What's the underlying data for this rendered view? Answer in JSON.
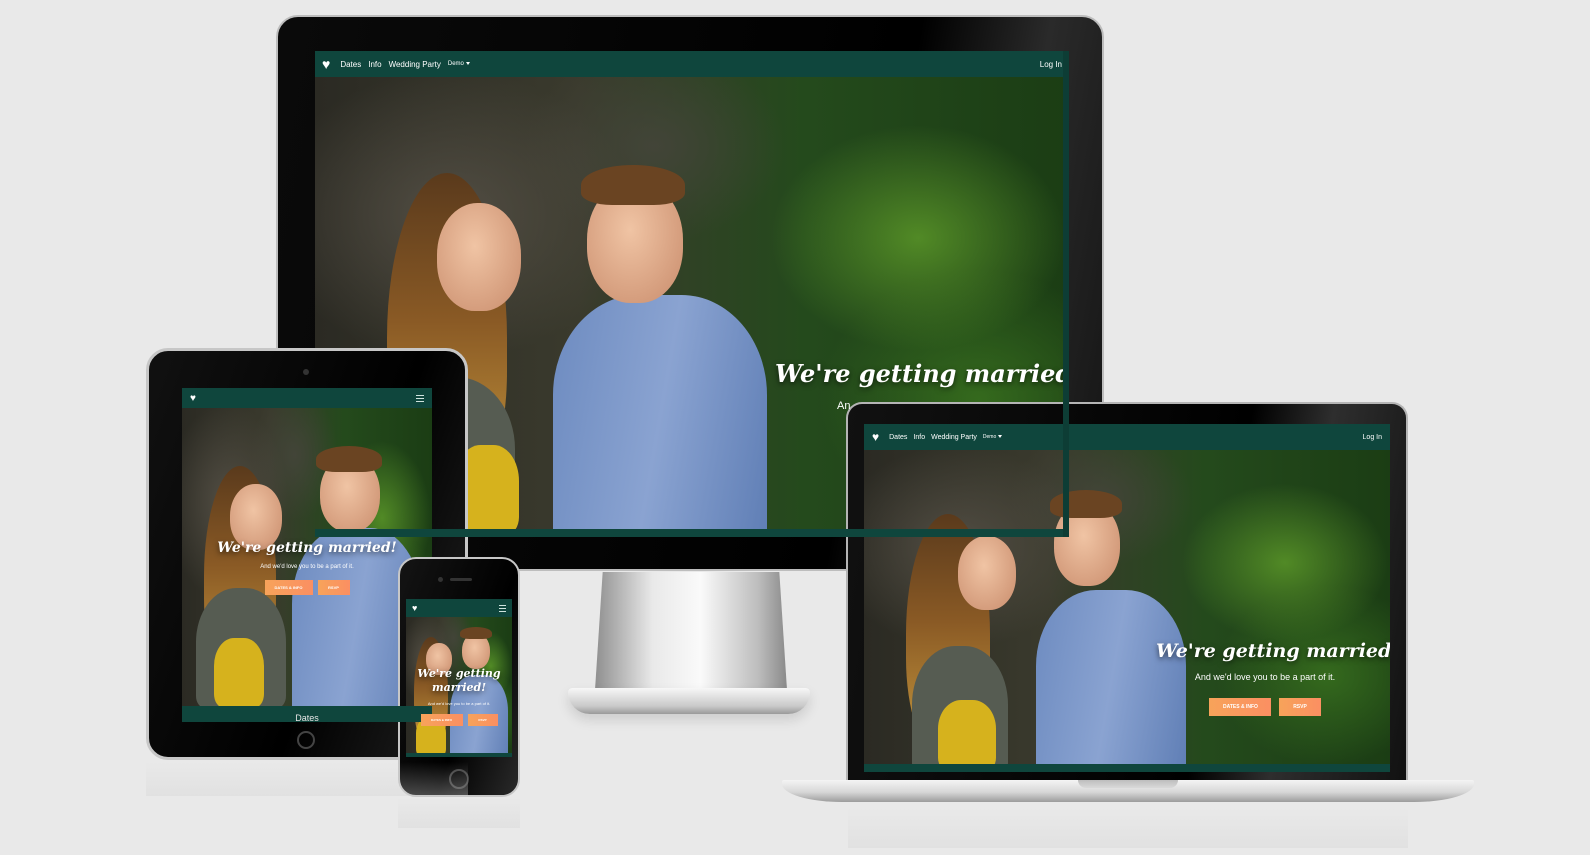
{
  "site": {
    "brand_icon": "heart-icon",
    "nav": {
      "links": [
        "Dates",
        "Info",
        "Wedding Party"
      ],
      "dropdown_label": "Demo",
      "login_label": "Log In",
      "menu_icon": "hamburger-icon"
    },
    "hero": {
      "title": "We're getting married!",
      "subtitle": "And we'd love you to be a part of it.",
      "monitor_subtitle_visible": "An",
      "buttons": {
        "dates_info": "Dates & Info",
        "rsvp": "RSVP"
      }
    },
    "tablet_section_heading": "Dates"
  },
  "colors": {
    "navbar": "#0f463d",
    "button_gradient_start": "#f7a35a",
    "button_gradient_end": "#fb8f62",
    "background": "#e9e9e9"
  }
}
